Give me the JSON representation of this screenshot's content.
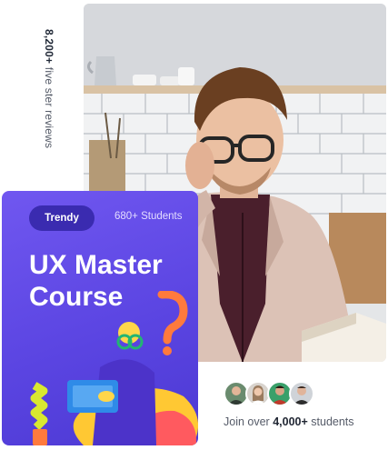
{
  "side_label": {
    "count": "8,200+",
    "text": " five ster reviews"
  },
  "card": {
    "badge": "Trendy",
    "students": "680+ Students",
    "title_line1": "UX Master",
    "title_line2": "Course",
    "colors": {
      "background": "#5b45e2",
      "badge_bg": "#3a2bb0"
    }
  },
  "photo": {
    "icon": "student-reading-photo"
  },
  "social_proof": {
    "prefix": "Join over ",
    "count": "4,000+",
    "suffix": " students",
    "avatars": [
      "avatar-1",
      "avatar-2",
      "avatar-3",
      "avatar-4"
    ]
  }
}
